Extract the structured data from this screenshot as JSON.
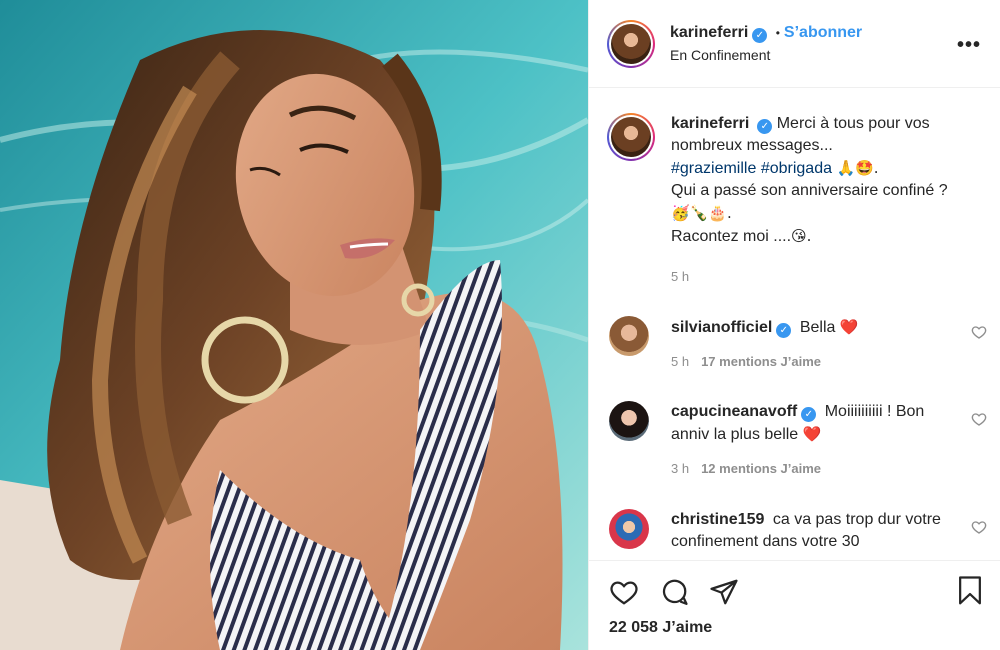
{
  "post": {
    "username": "karineferri",
    "follow_label": "S’abonner",
    "separator": "•",
    "location": "En Confinement",
    "more_label": "•••"
  },
  "caption": {
    "username": "karineferri",
    "line1": "Merci à tous pour vos nombreux messages...",
    "hashtag1": "#graziemille",
    "hashtag2": "#obrigada",
    "emojis1": "🙏🤩.",
    "line2": "Qui a passé son anniversaire confiné ?",
    "emojis2": "🥳🍾🎂.",
    "line3": "Racontez moi ....",
    "emojis3": "😘.",
    "time": "5 h"
  },
  "comments": [
    {
      "username": "silvianofficiel",
      "verified": true,
      "text": "Bella",
      "emoji": "❤️",
      "time": "5 h",
      "likes": "17 mentions J’aime"
    },
    {
      "username": "capucineanavoff",
      "verified": true,
      "text": "Moiiiiiiiiii ! Bon anniv la plus belle",
      "emoji": "❤️",
      "time": "3 h",
      "likes": "12 mentions J’aime"
    },
    {
      "username": "christine159",
      "verified": false,
      "text": "ca va pas trop dur votre confinement dans votre 30",
      "emoji": "",
      "time": "",
      "likes": ""
    }
  ],
  "actions": {
    "likes_count": "22 058 J’aime"
  },
  "colors": {
    "accent": "#3897f0",
    "hashtag": "#00376b",
    "muted": "#8e8e8e",
    "heart": "#ed4956"
  }
}
